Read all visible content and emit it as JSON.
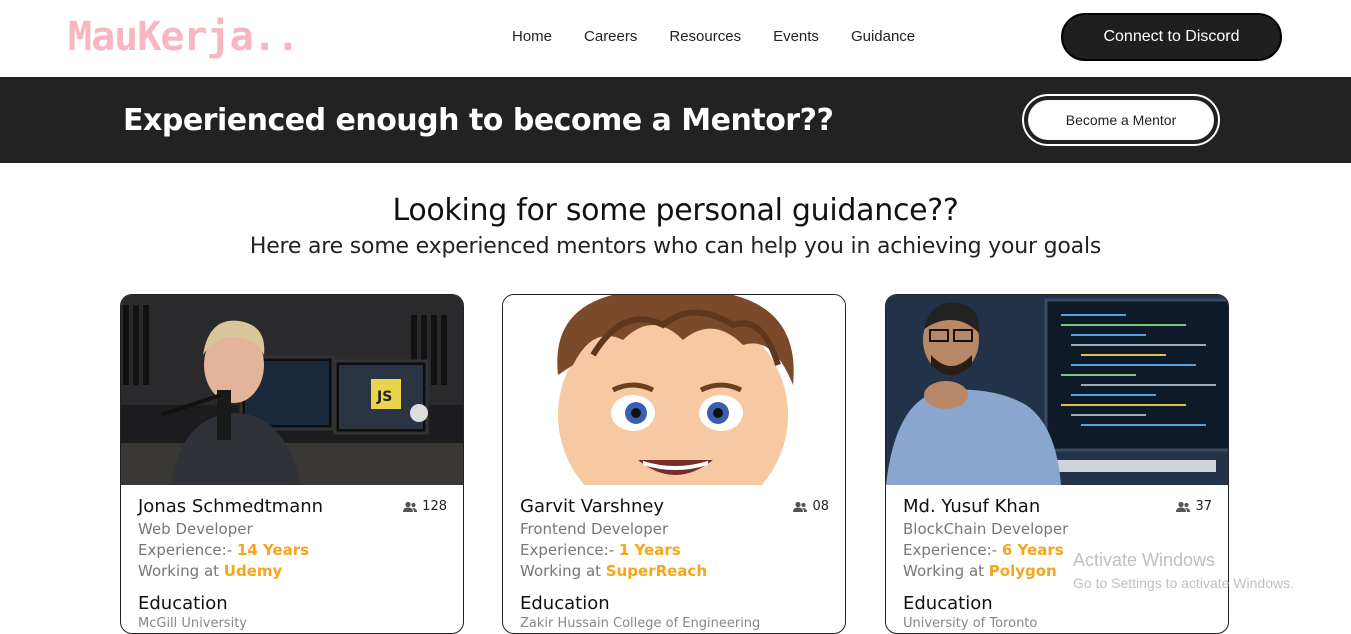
{
  "header": {
    "logo": "MauKerja..",
    "nav": [
      "Home",
      "Careers",
      "Resources",
      "Events",
      "Guidance"
    ],
    "discord_button": "Connect to Discord"
  },
  "banner": {
    "title": "Experienced enough to become a Mentor??",
    "button": "Become a Mentor"
  },
  "section": {
    "title": "Looking for some personal guidance??",
    "subtitle": "Here are some experienced mentors who can help you in achieving your goals"
  },
  "mentors": [
    {
      "name": "Jonas Schmedtmann",
      "count": "128",
      "role": "Web Developer",
      "exp_label": "Experience:- ",
      "exp_value": "14 Years",
      "work_label": "Working at ",
      "work_value": "Udemy",
      "edu_label": "Education",
      "school": "McGill University"
    },
    {
      "name": "Garvit Varshney",
      "count": "08",
      "role": "Frontend Developer",
      "exp_label": "Experience:- ",
      "exp_value": "1 Years",
      "work_label": "Working at ",
      "work_value": "SuperReach",
      "edu_label": "Education",
      "school": "Zakir Hussain College of Engineering"
    },
    {
      "name": "Md. Yusuf Khan",
      "count": "37",
      "role": "BlockChain Developer",
      "exp_label": "Experience:- ",
      "exp_value": "6 Years",
      "work_label": "Working at ",
      "work_value": "Polygon",
      "edu_label": "Education",
      "school": "University of Toronto"
    }
  ],
  "watermark": {
    "line1": "Activate Windows",
    "line2": "Go to Settings to activate Windows."
  },
  "colors": {
    "accent": "#f5a61c",
    "logo": "#f7b7c0",
    "banner_bg": "#222222"
  }
}
